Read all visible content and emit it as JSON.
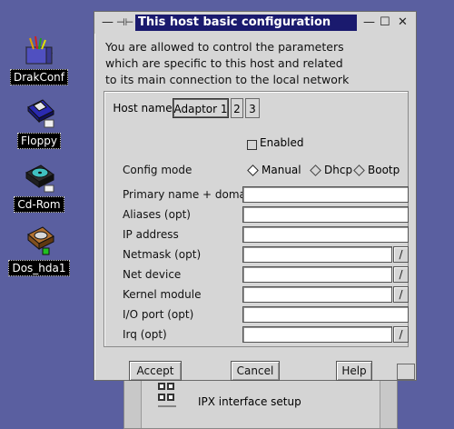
{
  "desktop": {
    "icons": [
      {
        "label": "DrakConf",
        "icon": "drakconf-icon"
      },
      {
        "label": "Floppy",
        "icon": "floppy-icon"
      },
      {
        "label": "Cd-Rom",
        "icon": "cdrom-icon"
      },
      {
        "label": "Dos_hda1",
        "icon": "harddisk-icon"
      }
    ]
  },
  "background_window": {
    "item_label": "IPX interface setup"
  },
  "dialog": {
    "title": "This host basic configuration",
    "titlebar_buttons": {
      "minimize": "—",
      "restore": "☐",
      "close": "✕",
      "left_dash": "—",
      "pin": "⊣⊢"
    },
    "intro": [
      "You are allowed to control the parameters",
      "which are specific to this host and related",
      "to its main connection to the local network"
    ],
    "tabs": [
      {
        "label": "Host name",
        "active": false
      },
      {
        "label": "Adaptor 1",
        "active": true
      },
      {
        "label": "2",
        "active": false
      },
      {
        "label": "3",
        "active": false
      }
    ],
    "enabled": {
      "label": "Enabled",
      "checked": false
    },
    "config_mode": {
      "label": "Config mode",
      "options": [
        "Manual",
        "Dhcp",
        "Bootp"
      ],
      "selected": "Manual"
    },
    "fields": [
      {
        "label": "Primary name + domain",
        "value": "",
        "combo": false
      },
      {
        "label": "Aliases (opt)",
        "value": "",
        "combo": false
      },
      {
        "label": "IP address",
        "value": "",
        "combo": false
      },
      {
        "label": "Netmask (opt)",
        "value": "",
        "combo": true
      },
      {
        "label": "Net device",
        "value": "",
        "combo": true
      },
      {
        "label": "Kernel module",
        "value": "",
        "combo": true
      },
      {
        "label": "I/O port (opt)",
        "value": "",
        "combo": false
      },
      {
        "label": "Irq (opt)",
        "value": "",
        "combo": true
      }
    ],
    "combo_glyph": "/",
    "buttons": {
      "accept": "Accept",
      "cancel": "Cancel",
      "help": "Help"
    }
  }
}
